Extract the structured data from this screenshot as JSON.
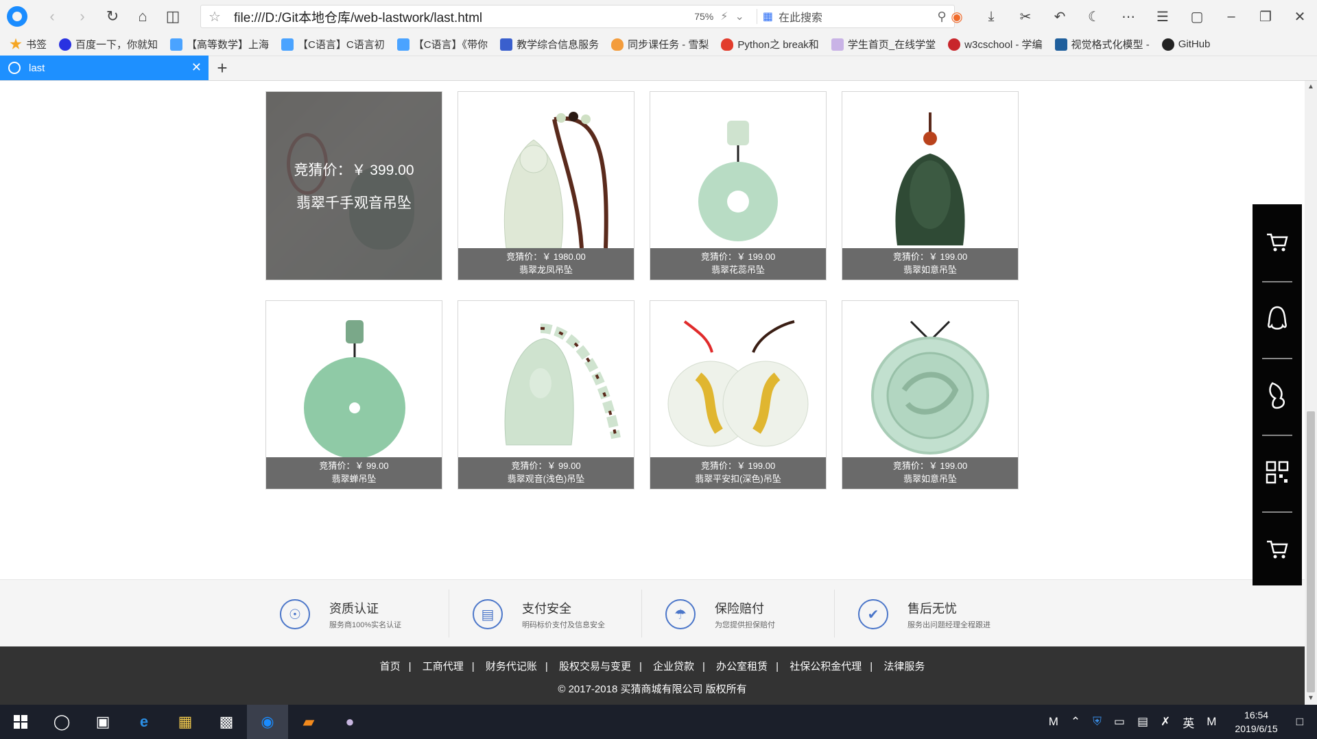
{
  "browser": {
    "url": "file:///D:/Git本地仓库/web-lastwork/last.html",
    "zoom": "75%",
    "search_placeholder": "在此搜索",
    "tab_title": "last",
    "bookmarks": [
      "书签",
      "百度一下，你就知",
      "【高等数学】上海",
      "【C语言】C语言初",
      "【C语言】《带你",
      "教学综合信息服务",
      "同步课任务 - 雪梨",
      "Python之 break和",
      "学生首页_在线学堂",
      "w3cschool - 学编",
      "视觉格式化模型 -",
      "GitHub"
    ]
  },
  "products": [
    {
      "price": "竞猜价：￥ 399.00",
      "name": "翡翠千手观音吊坠",
      "state": "hover"
    },
    {
      "price": "竞猜价：￥ 1980.00",
      "name": "翡翠龙凤吊坠"
    },
    {
      "price": "竞猜价：￥ 199.00",
      "name": "翡翠花蕊吊坠"
    },
    {
      "price": "竞猜价：￥ 199.00",
      "name": "翡翠如意吊坠"
    },
    {
      "price": "竞猜价：￥ 99.00",
      "name": "翡翠蝉吊坠"
    },
    {
      "price": "竞猜价：￥ 99.00",
      "name": "翡翠观音(浅色)吊坠"
    },
    {
      "price": "竞猜价：￥ 199.00",
      "name": "翡翠平安扣(深色)吊坠"
    },
    {
      "price": "竞猜价：￥ 199.00",
      "name": "翡翠如意吊坠"
    }
  ],
  "services": [
    {
      "title": "资质认证",
      "desc": "服务商100%实名认证",
      "icon": "certificate-icon"
    },
    {
      "title": "支付安全",
      "desc": "明码标价支付及信息安全",
      "icon": "wallet-icon"
    },
    {
      "title": "保险赔付",
      "desc": "为您提供担保赔付",
      "icon": "umbrella-icon"
    },
    {
      "title": "售后无忧",
      "desc": "服务出问题经理全程跟进",
      "icon": "thumbs-up-icon"
    }
  ],
  "footer": {
    "links": [
      "首页",
      "工商代理",
      "财务代记账",
      "股权交易与变更",
      "企业贷款",
      "办公室租赁",
      "社保公积金代理",
      "法律服务"
    ],
    "separator": "|",
    "copyright": "© 2017-2018 买猜商城有限公司 版权所有"
  },
  "sidebar": {
    "items": [
      "cart-icon",
      "qq-icon",
      "footprint-icon",
      "qrcode-icon",
      "cart-icon"
    ]
  },
  "taskbar": {
    "time": "16:54",
    "date": "2019/6/15",
    "ime": "英",
    "ime_mode": "M"
  },
  "colors": {
    "tab_active": "#1e90ff",
    "caption_bg": "#5a5a5a",
    "service_accent": "#4b76c9",
    "footer_bg": "#333333",
    "sidebar_bg": "#050505"
  }
}
